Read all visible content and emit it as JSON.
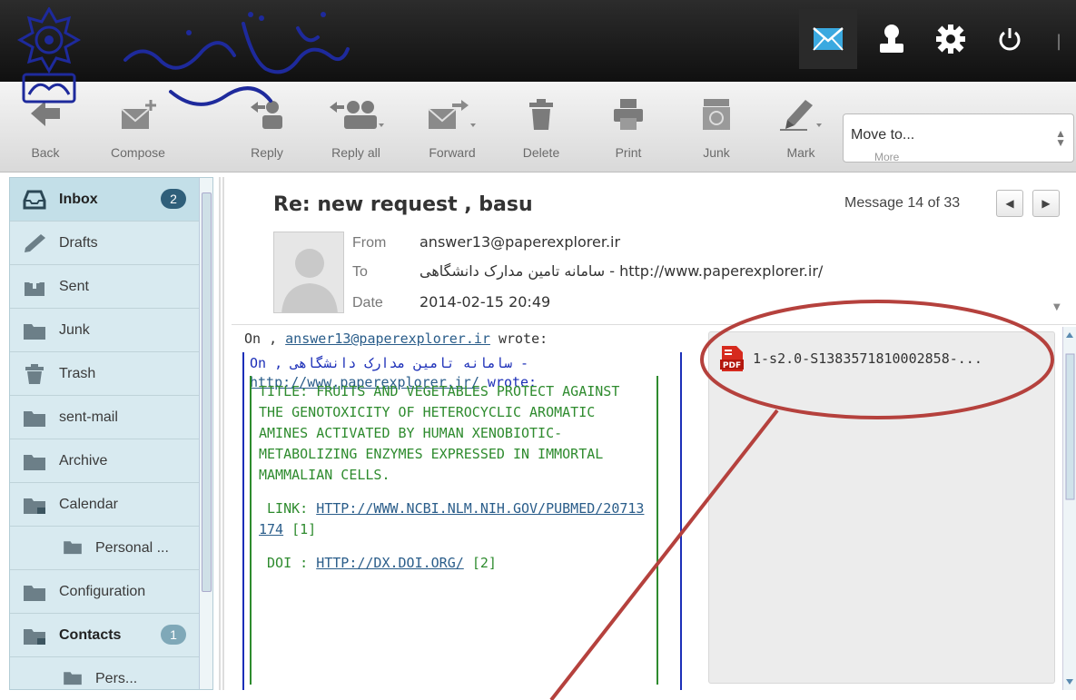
{
  "toolbar": {
    "back": "Back",
    "compose": "Compose",
    "reply": "Reply",
    "reply_all": "Reply all",
    "forward": "Forward",
    "delete": "Delete",
    "print": "Print",
    "junk": "Junk",
    "mark": "Mark",
    "move_to": "Move to...",
    "more": "More"
  },
  "sidebar": {
    "items": [
      {
        "label": "Inbox",
        "badge": "2",
        "icon": "inbox-icon"
      },
      {
        "label": "Drafts",
        "icon": "pencil-icon"
      },
      {
        "label": "Sent",
        "icon": "sent-icon"
      },
      {
        "label": "Junk",
        "icon": "folder-icon"
      },
      {
        "label": "Trash",
        "icon": "trash-icon"
      },
      {
        "label": "sent-mail",
        "icon": "folder-icon"
      },
      {
        "label": "Archive",
        "icon": "folder-icon"
      },
      {
        "label": "Calendar",
        "icon": "folder-icon"
      },
      {
        "label": "Personal ...",
        "icon": "folder-icon"
      },
      {
        "label": "Configuration",
        "icon": "folder-icon"
      },
      {
        "label": "Contacts",
        "badge": "1",
        "icon": "folder-icon"
      },
      {
        "label": "Pers...",
        "icon": "folder-icon"
      }
    ]
  },
  "message": {
    "subject": "Re: new request , basu",
    "counter": "Message 14 of 33",
    "from_label": "From",
    "from": "answer13@paperexplorer.ir",
    "to_label": "To",
    "to": "سامانه تامین مدارک دانشگاهی - http://www.paperexplorer.ir/",
    "date_label": "Date",
    "date": "2014-02-15 20:49"
  },
  "body": {
    "line1_prefix": "On ,",
    "line1_link": "answer13@paperexplorer.ir",
    "line1_suffix": "wrote:",
    "q1_line1": "- سامانه تامین مدارک دانشگاهی , On",
    "q1_link": "http://www.paperexplorer.ir/",
    "q1_suffix": "wrote:",
    "title_block": "TITLE: FRUITS AND VEGETABLES PROTECT AGAINST THE GENOTOXICITY OF HETEROCYCLIC AROMATIC AMINES ACTIVATED BY HUMAN XENOBIOTIC-METABOLIZING ENZYMES EXPRESSED IN IMMORTAL MAMMALIAN CELLS.",
    "link_label": "LINK:",
    "link_url": "HTTP://WWW.NCBI.NLM.NIH.GOV/PUBMED/20713174",
    "link_ref": "[1]",
    "doi_label": "DOI :",
    "doi_url": "HTTP://DX.DOI.ORG/",
    "doi_ref": "[2]"
  },
  "attachment": {
    "filename": "1-s2.0-S1383571810002858-...",
    "icon": "pdf-icon",
    "icon_text": "PDF"
  },
  "colors": {
    "annotation": "#b5413d",
    "quote_blue": "#1c2fb8",
    "quote_green": "#2e8b2e",
    "sidebar_bg": "#d8eaf0"
  }
}
